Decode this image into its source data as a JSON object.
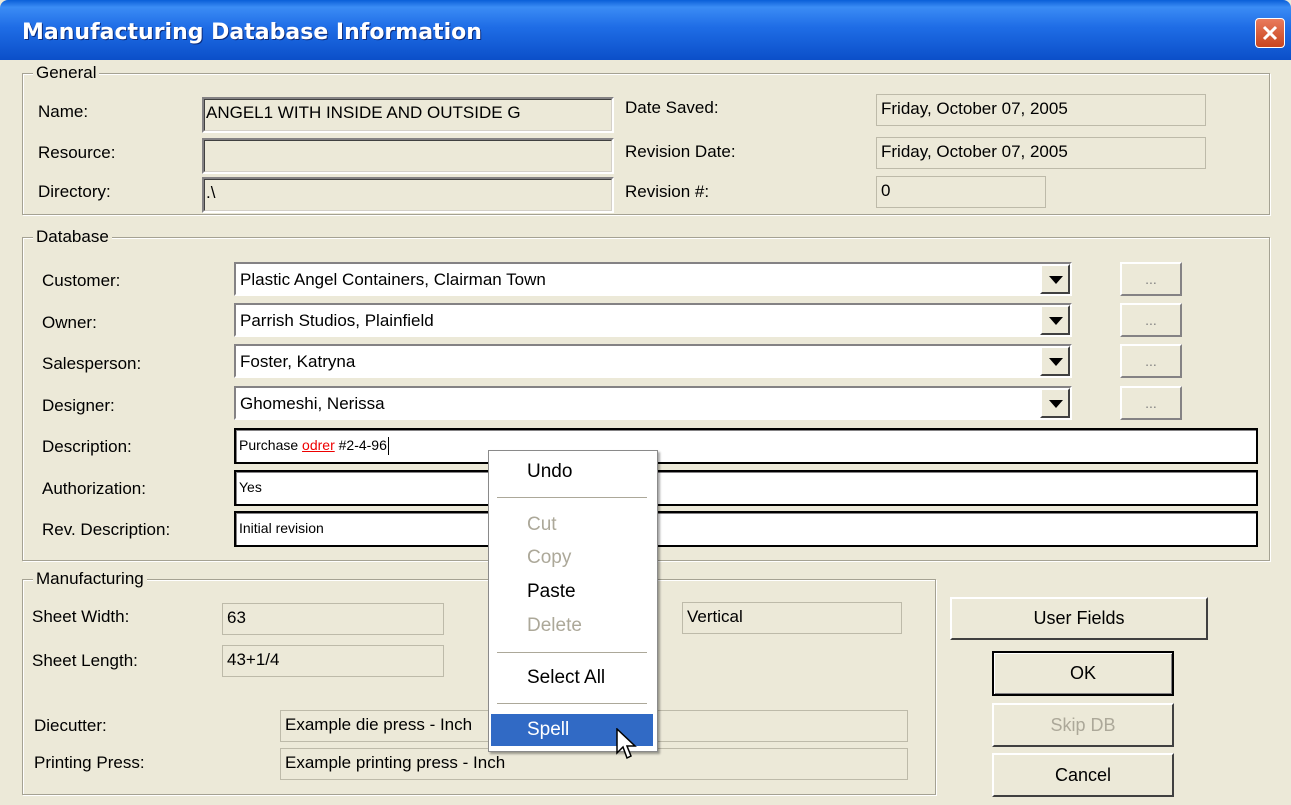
{
  "window": {
    "title": "Manufacturing Database Information"
  },
  "general": {
    "legend": "General",
    "name_label": "Name:",
    "name_value": "ANGEL1 WITH INSIDE AND OUTSIDE G",
    "resource_label": "Resource:",
    "resource_value": "",
    "directory_label": "Directory:",
    "directory_value": ".\\",
    "date_saved_label": "Date Saved:",
    "date_saved_value": "Friday, October 07, 2005",
    "revision_date_label": "Revision Date:",
    "revision_date_value": "Friday, October 07, 2005",
    "revision_num_label": "Revision #:",
    "revision_num_value": "0"
  },
  "database": {
    "legend": "Database",
    "customer_label": "Customer:",
    "customer_value": "Plastic Angel Containers, Clairman Town",
    "owner_label": "Owner:",
    "owner_value": "Parrish Studios, Plainfield",
    "salesperson_label": "Salesperson:",
    "salesperson_value": "Foster, Katryna",
    "designer_label": "Designer:",
    "designer_value": "Ghomeshi, Nerissa",
    "ellipsis": "...",
    "description_label": "Description:",
    "description_pre": "Purchase ",
    "description_misspelled": "odrer",
    "description_post": " #2-4-96",
    "authorization_label": "Authorization:",
    "authorization_value": "Yes",
    "rev_description_label": "Rev. Description:",
    "rev_description_value": "Initial revision"
  },
  "manufacturing": {
    "legend": "Manufacturing",
    "sheet_width_label": "Sheet Width:",
    "sheet_width_value": "63",
    "sheet_length_label": "Sheet Length:",
    "sheet_length_value": "43+1/4",
    "grain_value": "Vertical",
    "diecutter_label": "Diecutter:",
    "diecutter_value": "Example die press - Inch",
    "printing_press_label": "Printing Press:",
    "printing_press_value": "Example printing press - Inch"
  },
  "buttons": {
    "user_fields": "User Fields",
    "ok": "OK",
    "skip_db": "Skip DB",
    "cancel": "Cancel"
  },
  "context_menu": {
    "undo": "Undo",
    "cut": "Cut",
    "copy": "Copy",
    "paste": "Paste",
    "delete": "Delete",
    "select_all": "Select All",
    "spell": "Spell"
  }
}
